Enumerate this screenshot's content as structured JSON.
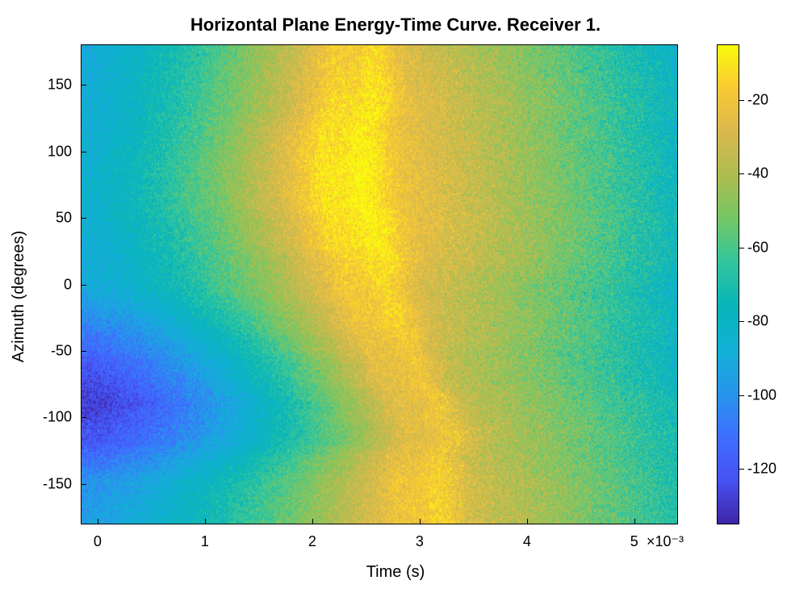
{
  "chart_data": {
    "type": "heatmap",
    "title": "Horizontal Plane Energy-Time Curve. Receiver 1.",
    "xlabel": "Time (s)",
    "ylabel": "Azimuth (degrees)",
    "x_range": [
      -0.00015,
      0.0054
    ],
    "y_range": [
      -180,
      180
    ],
    "x_ticks": [
      0,
      1,
      2,
      3,
      4,
      5
    ],
    "x_tick_scale_label": "×10⁻³",
    "y_ticks": [
      -150,
      -100,
      -50,
      0,
      50,
      100,
      150
    ],
    "colorbar": {
      "range": [
        -135,
        -5
      ],
      "ticks": [
        -120,
        -100,
        -80,
        -60,
        -40,
        -20
      ],
      "colormap": "parula"
    },
    "note": "Heatmap of energy-time per azimuth. Values below are approximate dB levels. Peak energy (≈ -10 dB) near t≈2.2e-3 s for upper azimuths and near t≈2.8e-3 s for lower azimuths; low energy (≈ -100 to -130 dB) at early time (t<0.5e-3 s) especially around az≈-90°.",
    "azimuth_grid": [
      -180,
      -170,
      -160,
      -150,
      -140,
      -130,
      -120,
      -110,
      -100,
      -90,
      -80,
      -70,
      -60,
      -50,
      -40,
      -30,
      -20,
      -10,
      0,
      10,
      20,
      30,
      40,
      50,
      60,
      70,
      80,
      90,
      100,
      110,
      120,
      130,
      140,
      150,
      160,
      170,
      180
    ],
    "time_grid_ms": [
      0.0,
      0.2,
      0.4,
      0.6,
      0.8,
      1.0,
      1.2,
      1.4,
      1.6,
      1.8,
      2.0,
      2.2,
      2.4,
      2.6,
      2.8,
      3.0,
      3.2,
      3.4,
      3.6,
      3.8,
      4.0,
      4.2,
      4.4,
      4.6,
      4.8,
      5.0,
      5.2,
      5.4
    ],
    "approx_peak_time_ms_by_azimuth": {
      "-180": 2.8,
      "-170": 2.8,
      "-160": 2.8,
      "-150": 2.8,
      "-140": 2.8,
      "-130": 2.8,
      "-120": 2.9,
      "-110": 2.9,
      "-100": 2.8,
      "-90": 2.8,
      "-80": 2.7,
      "-70": 2.6,
      "-60": 2.6,
      "-50": 2.5,
      "-40": 2.5,
      "-30": 2.4,
      "-20": 2.4,
      "-10": 2.3,
      "0": 2.3,
      "10": 2.3,
      "20": 2.3,
      "30": 2.2,
      "40": 2.2,
      "50": 2.2,
      "60": 2.1,
      "70": 2.1,
      "80": 2.1,
      "90": 2.1,
      "100": 2.1,
      "110": 2.1,
      "120": 2.1,
      "130": 2.2,
      "140": 2.2,
      "150": 2.2,
      "160": 2.2,
      "170": 2.2,
      "180": 2.2
    },
    "approx_peak_db_by_azimuth": {
      "-180": -20,
      "-150": -20,
      "-120": -25,
      "-90": -25,
      "-60": -25,
      "-30": -20,
      "0": -18,
      "30": -12,
      "60": -10,
      "90": -10,
      "120": -12,
      "150": -15,
      "180": -18
    },
    "approx_min_early_db_by_azimuth": {
      "-180": -95,
      "-150": -100,
      "-120": -120,
      "-90": -130,
      "-60": -120,
      "-30": -105,
      "0": -90,
      "30": -88,
      "60": -85,
      "90": -85,
      "120": -88,
      "150": -88,
      "180": -90
    }
  }
}
